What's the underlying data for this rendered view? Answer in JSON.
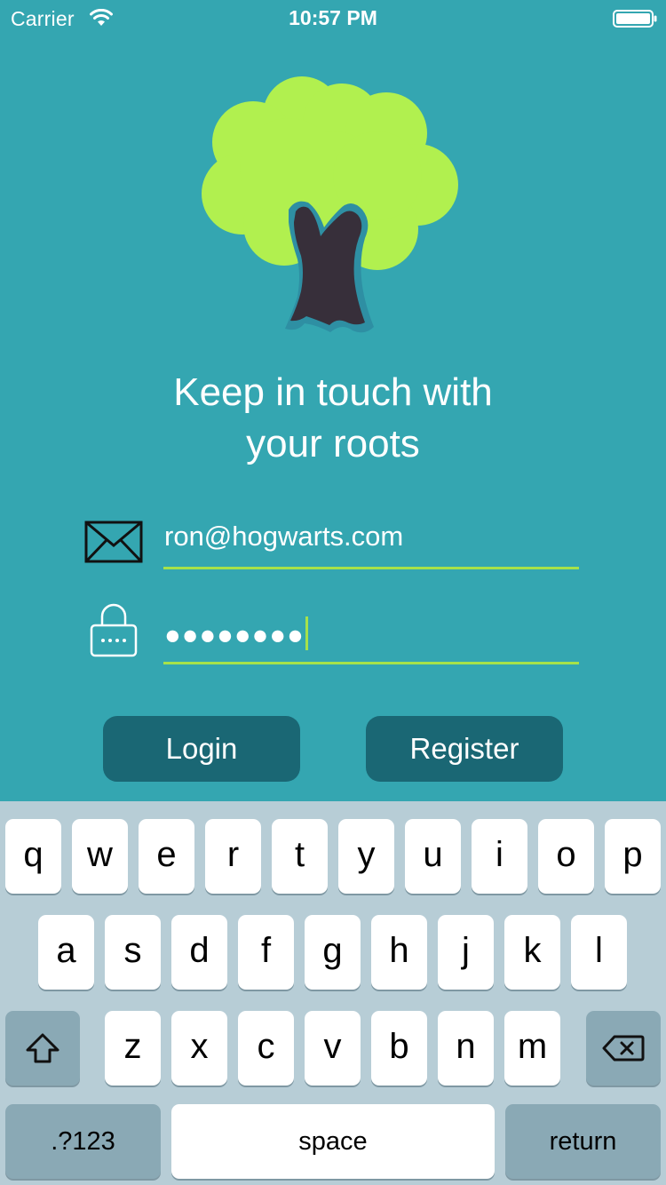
{
  "status_bar": {
    "carrier": "Carrier",
    "time": "10:57 PM",
    "wifi_icon": "wifi-icon",
    "battery_icon": "battery-icon"
  },
  "logo": {
    "icon": "tree-icon",
    "colors": {
      "foliage": "#b1f04f",
      "trunk": "#372f3a",
      "outline": "#2e8fa3"
    }
  },
  "tagline": {
    "line1": "Keep in touch with",
    "line2": "your roots"
  },
  "form": {
    "email": {
      "icon": "envelope-icon",
      "value": "ron@hogwarts.com"
    },
    "password": {
      "icon": "lock-icon",
      "masked_value": "●●●●●●●●"
    }
  },
  "buttons": {
    "login": "Login",
    "register": "Register"
  },
  "keyboard": {
    "row1": [
      "q",
      "w",
      "e",
      "r",
      "t",
      "y",
      "u",
      "i",
      "o",
      "p"
    ],
    "row2": [
      "a",
      "s",
      "d",
      "f",
      "g",
      "h",
      "j",
      "k",
      "l"
    ],
    "row3": [
      "z",
      "x",
      "c",
      "v",
      "b",
      "n",
      "m"
    ],
    "shift_icon": "shift-icon",
    "delete_icon": "backspace-icon",
    "numbers": ".?123",
    "space": "space",
    "return": "return"
  },
  "colors": {
    "background": "#34a6b1",
    "button": "#1a6774",
    "accent": "#a6e24a",
    "keyboard": "#b7cdd6",
    "key_function": "#8aa9b5"
  }
}
